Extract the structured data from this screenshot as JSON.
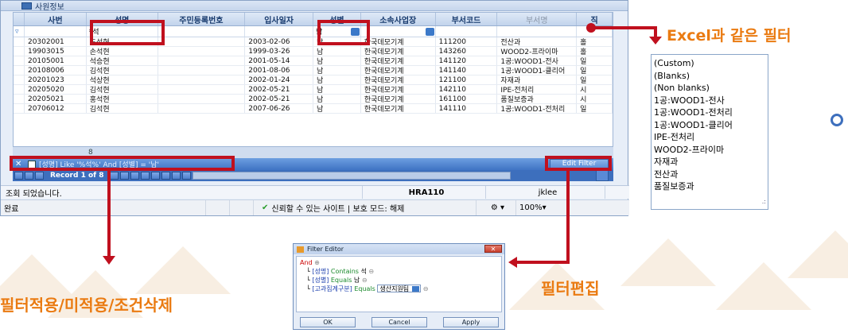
{
  "window": {
    "title": "사원정보",
    "columns": [
      "사번",
      "성명",
      "주민등록번호",
      "입사일자",
      "성별",
      "소속사업장",
      "부서코드",
      "부서명",
      "직"
    ],
    "filter_row": {
      "name": "*석",
      "gender": "남"
    },
    "rows": [
      [
        "20302001",
        "도석현",
        "",
        "2003-02-06",
        "남",
        "한국데모기계",
        "111200",
        "전산과",
        "홀"
      ],
      [
        "19903015",
        "손석현",
        "",
        "1999-03-26",
        "남",
        "한국데모기계",
        "143260",
        "WOOD2-프라이마",
        "홀"
      ],
      [
        "20105001",
        "석승현",
        "",
        "2001-05-14",
        "남",
        "한국데모기계",
        "141120",
        "1공:WOOD1-전사",
        "일"
      ],
      [
        "20108006",
        "김석현",
        "",
        "2001-08-06",
        "남",
        "한국데모기계",
        "141140",
        "1공:WOOD1-클리어",
        "일"
      ],
      [
        "20201023",
        "석상현",
        "",
        "2002-01-24",
        "남",
        "한국데모기계",
        "121100",
        "자재과",
        "일"
      ],
      [
        "20205020",
        "김석현",
        "",
        "2002-05-21",
        "남",
        "한국데모기계",
        "142110",
        "IPE-전처리",
        "시"
      ],
      [
        "20205021",
        "홍석현",
        "",
        "2002-05-21",
        "남",
        "한국데모기계",
        "161100",
        "품질보증과",
        "시"
      ],
      [
        "20706012",
        "김석현",
        "",
        "2007-06-26",
        "남",
        "한국데모기계",
        "141110",
        "1공:WOOD1-전처리",
        "일"
      ]
    ],
    "summary_count": "8",
    "filter_expression": "[성명] Like '%석%' And [성별] = '남'",
    "edit_filter_label": "Edit Filter",
    "record_label": "Record 1 of 8",
    "status_message": "조회 되었습니다.",
    "program_code": "HRA110",
    "user": "jklee",
    "browser_left": "완료",
    "browser_trust": "신뢰할 수 있는 사이트 | 보호 모드: 해제",
    "zoom": "100%"
  },
  "excel_filter": {
    "label": "Excel과 같은 필터",
    "items": [
      "(Custom)",
      "(Blanks)",
      "(Non blanks)",
      "1공:WOOD1-전사",
      "1공:WOOD1-전처리",
      "1공:WOOD1-클리어",
      "IPE-전처리",
      "WOOD2-프라이마",
      "자재과",
      "전산과",
      "품질보증과"
    ]
  },
  "filter_editor": {
    "title": "Filter Editor",
    "root_op": "And",
    "conditions": [
      {
        "field": "[성명]",
        "op": "Contains",
        "value": "석"
      },
      {
        "field": "[성별]",
        "op": "Equals",
        "value": "남"
      },
      {
        "field": "[고과집계구분]",
        "op": "Equals",
        "value": "생산지원팀"
      }
    ],
    "ok": "OK",
    "cancel": "Cancel",
    "apply": "Apply"
  },
  "annotations": {
    "filter_apply": "필터적용/미적용/조건삭제",
    "filter_edit": "필터편집"
  },
  "colors": {
    "highlight": "#c0101e",
    "note": "#ea7b12",
    "nav": "#3d6fbd"
  }
}
